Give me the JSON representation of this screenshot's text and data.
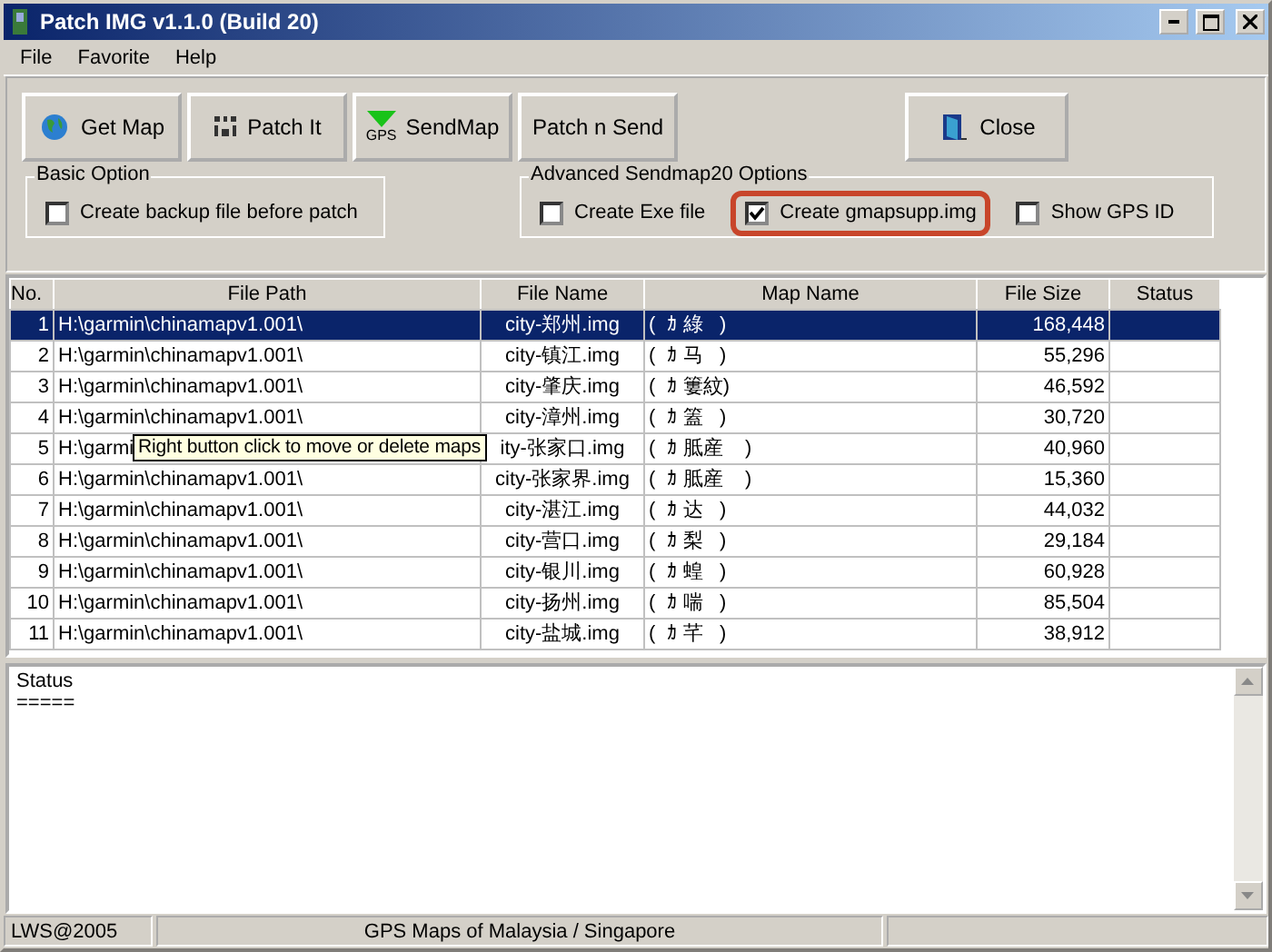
{
  "window": {
    "title": "Patch IMG v1.1.0 (Build 20)"
  },
  "menu": [
    "File",
    "Favorite",
    "Help"
  ],
  "buttons": [
    {
      "label": "Get Map",
      "kind": "globe"
    },
    {
      "label": "Patch It",
      "kind": "patch"
    },
    {
      "label": "SendMap",
      "kind": "gps",
      "icon_text": "GPS"
    },
    {
      "label": "Patch n Send",
      "kind": "plain"
    },
    {
      "label": "Close",
      "kind": "door"
    }
  ],
  "basic_option": {
    "title": "Basic Option",
    "options": [
      {
        "label": "Create backup file before patch",
        "checked": false,
        "highlighted": false
      }
    ]
  },
  "advanced_option": {
    "title": "Advanced  Sendmap20  Options",
    "options": [
      {
        "label": "Create Exe file",
        "checked": false,
        "highlighted": false
      },
      {
        "label": "Create gmapsupp.img",
        "checked": true,
        "highlighted": true
      },
      {
        "label": "Show GPS ID",
        "checked": false,
        "highlighted": false
      }
    ]
  },
  "table": {
    "columns": [
      "No.",
      "File Path",
      "File Name",
      "Map Name",
      "File Size",
      "Status"
    ],
    "rows": [
      {
        "no": "1",
        "path": "H:\\garmin\\chinamapv1.001\\",
        "file": "city-郑州.img",
        "map": "(  ｶ 綠   )",
        "size": "168,448",
        "selected": true
      },
      {
        "no": "2",
        "path": "H:\\garmin\\chinamapv1.001\\",
        "file": "city-镇江.img",
        "map": "(  ｶ 马   )",
        "size": "55,296",
        "selected": false
      },
      {
        "no": "3",
        "path": "H:\\garmin\\chinamapv1.001\\",
        "file": "city-肇庆.img",
        "map": "(  ｶ 簍紋)",
        "size": "46,592",
        "selected": false
      },
      {
        "no": "4",
        "path": "H:\\garmin\\chinamapv1.001\\",
        "file": "city-漳州.img",
        "map": "(  ｶ 篕   )",
        "size": "30,720",
        "selected": false
      },
      {
        "no": "5",
        "path": "H:\\garmi",
        "file": "ity-张家口.img",
        "map": "(  ｶ 胝産    )",
        "size": "40,960",
        "selected": false
      },
      {
        "no": "6",
        "path": "H:\\garmin\\chinamapv1.001\\",
        "file": "city-张家界.img",
        "map": "(  ｶ 胝産    )",
        "size": "15,360",
        "selected": false
      },
      {
        "no": "7",
        "path": "H:\\garmin\\chinamapv1.001\\",
        "file": "city-湛江.img",
        "map": "(  ｶ 达   )",
        "size": "44,032",
        "selected": false
      },
      {
        "no": "8",
        "path": "H:\\garmin\\chinamapv1.001\\",
        "file": "city-营口.img",
        "map": "(  ｶ 梨   )",
        "size": "29,184",
        "selected": false
      },
      {
        "no": "9",
        "path": "H:\\garmin\\chinamapv1.001\\",
        "file": "city-银川.img",
        "map": "(  ｶ 蝗   )",
        "size": "60,928",
        "selected": false
      },
      {
        "no": "10",
        "path": "H:\\garmin\\chinamapv1.001\\",
        "file": "city-扬州.img",
        "map": "(  ｶ 喘   )",
        "size": "85,504",
        "selected": false
      },
      {
        "no": "11",
        "path": "H:\\garmin\\chinamapv1.001\\",
        "file": "city-盐城.img",
        "map": "(  ｶ 芊   )",
        "size": "38,912",
        "selected": false
      }
    ],
    "tooltip": "Right button click to move or delete maps"
  },
  "status_log": [
    "Status",
    "====="
  ],
  "status_bar": [
    "LWS@2005",
    "GPS Maps of Malaysia / Singapore"
  ]
}
